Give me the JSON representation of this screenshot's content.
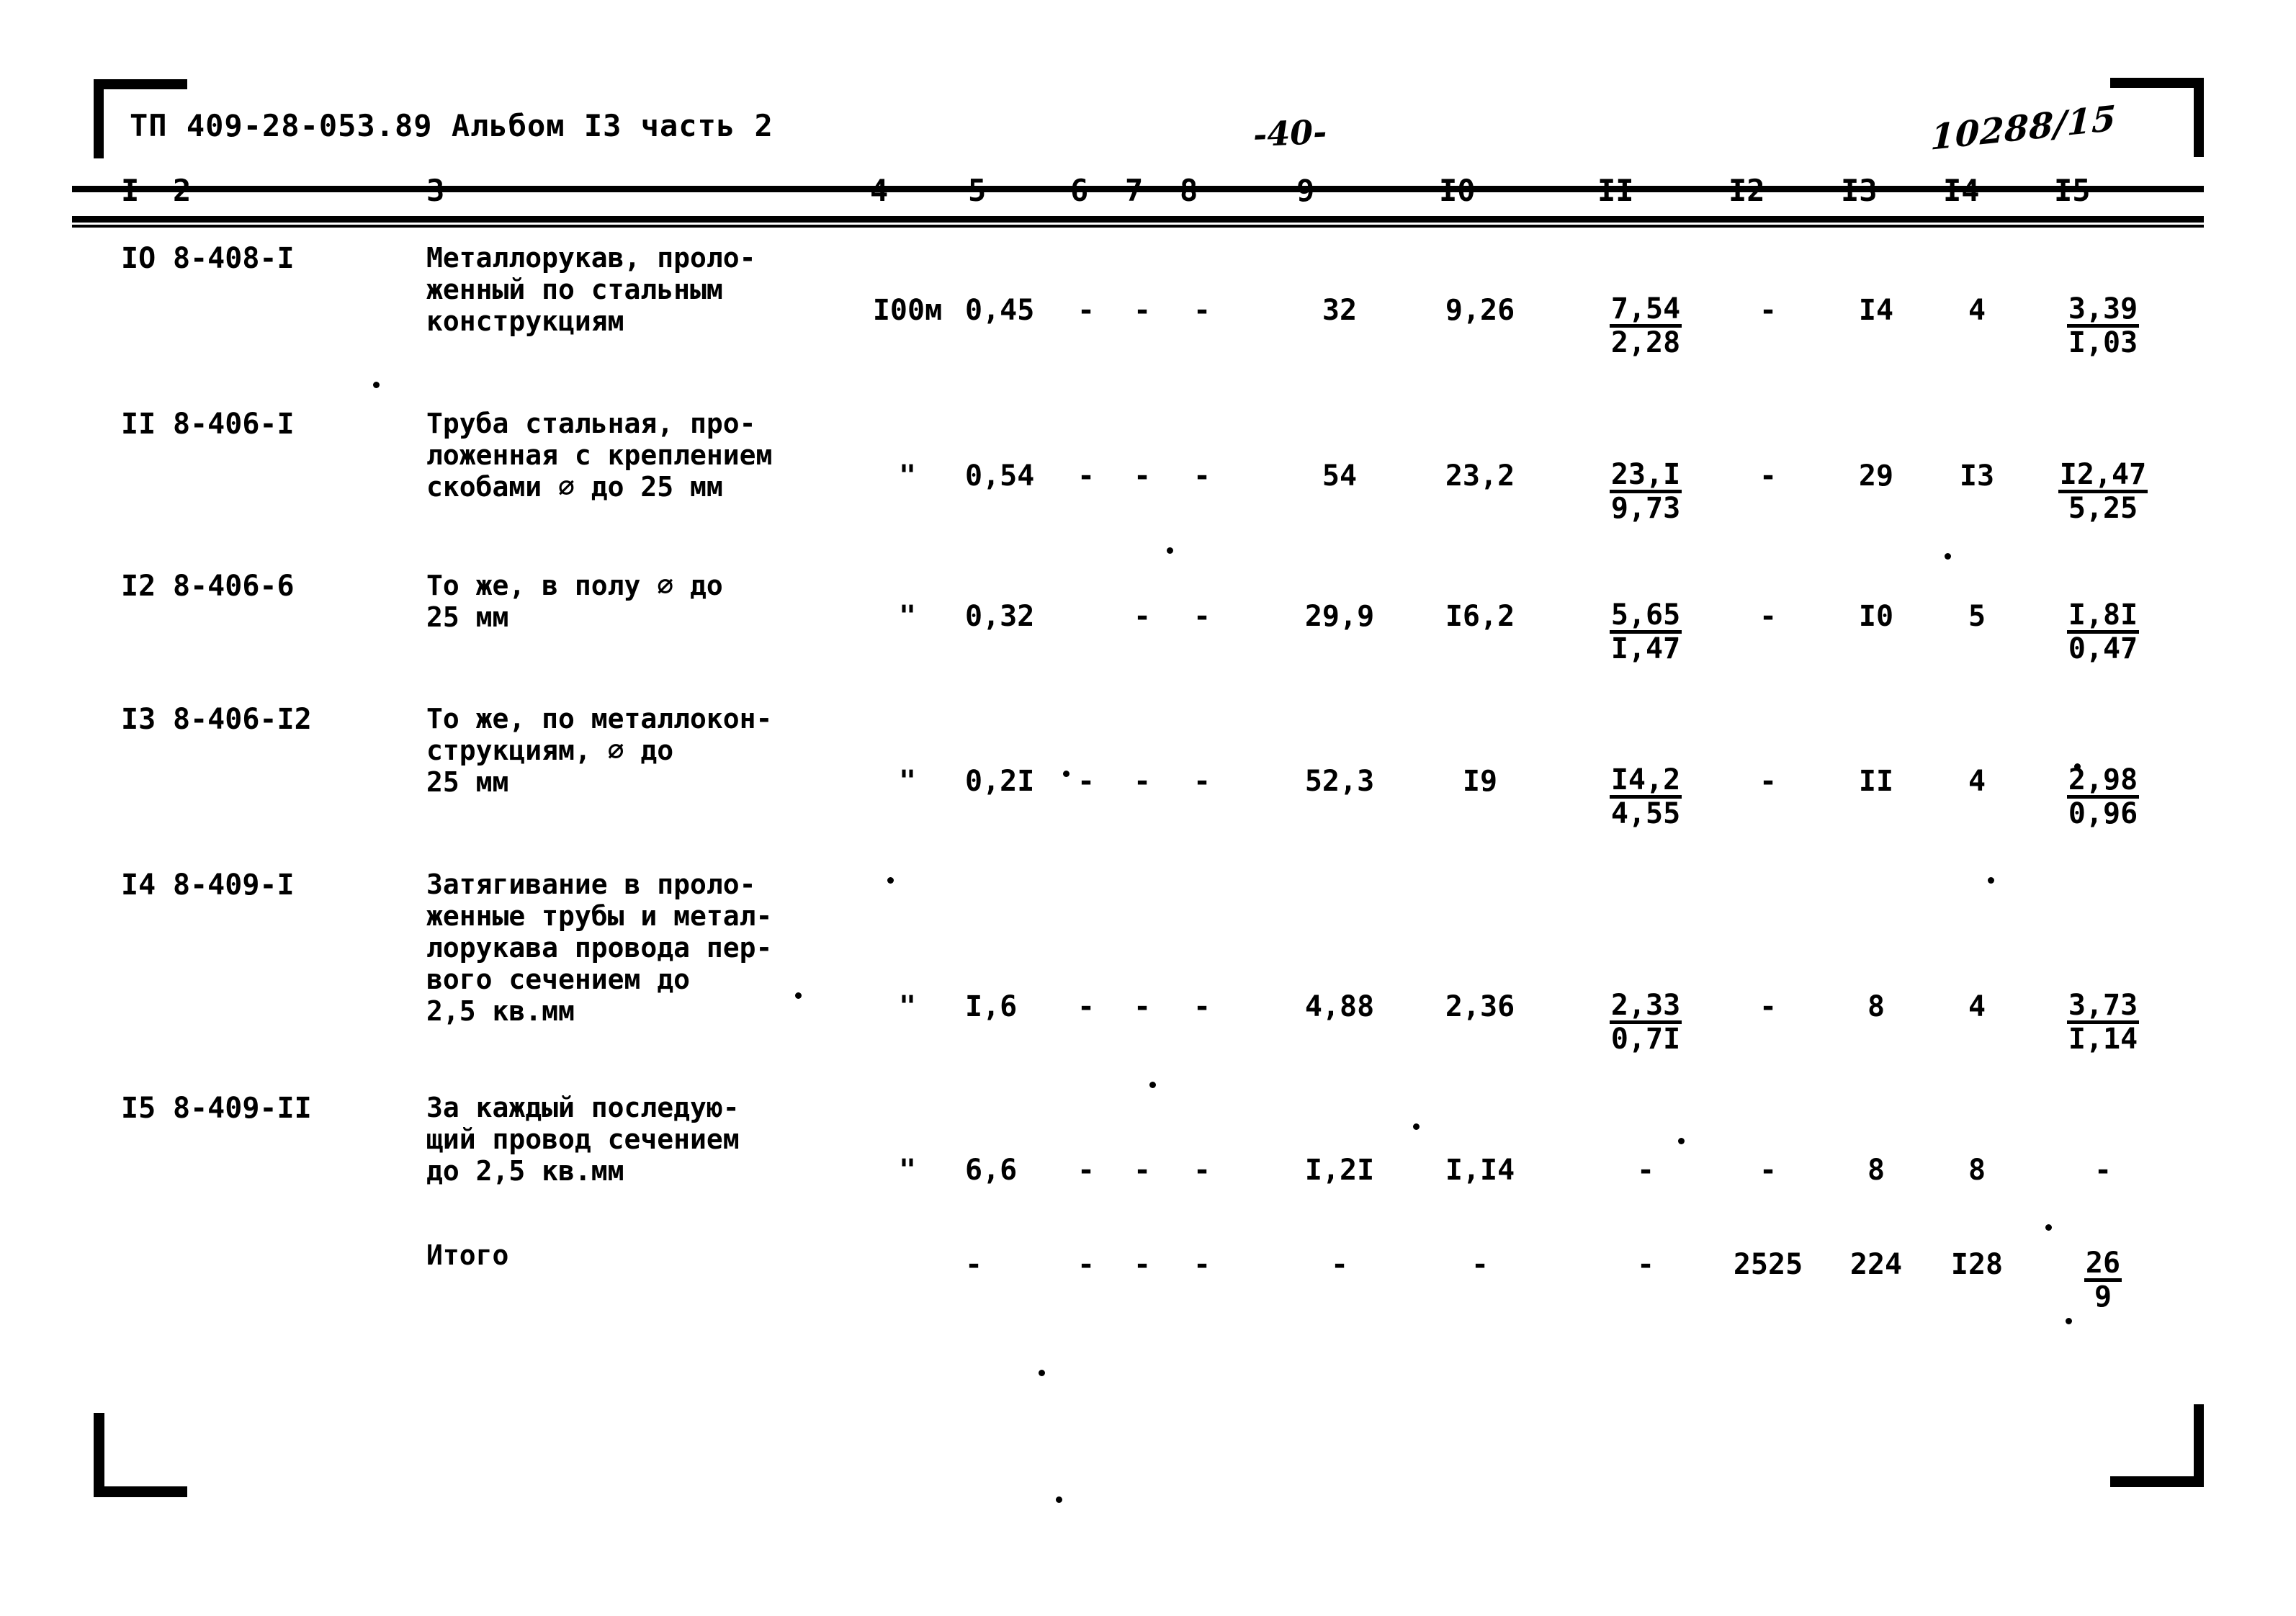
{
  "header": {
    "doc_code": "ТП 409-28-053.89 Альбом I3 часть 2",
    "page_number": "-40-",
    "stamp_number": "10288/15"
  },
  "table": {
    "column_numbers": [
      "I",
      "2",
      "3",
      "4",
      "5",
      "6",
      "7",
      "8",
      "9",
      "I0",
      "II",
      "I2",
      "I3",
      "I4",
      "I5"
    ],
    "rows": [
      {
        "no": "IO",
        "code": "8-408-I",
        "name": "Металлорукав, проло-\nженный по стальным\nконструкциям",
        "unit": "I00м",
        "c5": "0,45",
        "c6": "-",
        "c7": "-",
        "c8": "-",
        "c9": "32",
        "c10": "9,26",
        "c11_num": "7,54",
        "c11_den": "2,28",
        "c12": "-",
        "c13": "I4",
        "c14": "4",
        "c15_num": "3,39",
        "c15_den": "I,03"
      },
      {
        "no": "II",
        "code": "8-406-I",
        "name": "Труба стальная, про-\nложенная с креплением\nскобами ⌀ до 25 мм",
        "unit": "\"",
        "c5": "0,54",
        "c6": "-",
        "c7": "-",
        "c8": "-",
        "c9": "54",
        "c10": "23,2",
        "c11_num": "23,I",
        "c11_den": "9,73",
        "c12": "-",
        "c13": "29",
        "c14": "I3",
        "c15_num": "I2,47",
        "c15_den": "5,25"
      },
      {
        "no": "I2",
        "code": "8-406-6",
        "name": "То же, в полу ⌀ до\n25 мм",
        "unit": "\"",
        "c5": "0,32",
        "c6": "",
        "c7": "-",
        "c8": "-",
        "c9": "29,9",
        "c10": "I6,2",
        "c11_num": "5,65",
        "c11_den": "I,47",
        "c12": "-",
        "c13": "I0",
        "c14": "5",
        "c15_num": "I,8I",
        "c15_den": "0,47"
      },
      {
        "no": "I3",
        "code": "8-406-I2",
        "name": "То же, по металлокон-\nструкциям, ⌀ до\n25 мм",
        "unit": "\"",
        "c5": "0,2I",
        "c6": "-",
        "c7": "-",
        "c8": "-",
        "c9": "52,3",
        "c10": "I9",
        "c11_num": "I4,2",
        "c11_den": "4,55",
        "c12": "-",
        "c13": "II",
        "c14": "4",
        "c15_num": "2,98",
        "c15_den": "0,96"
      },
      {
        "no": "I4",
        "code": "8-409-I",
        "name": "Затягивание в проло-\nженные трубы и метал-\nлорукава провода пер-\nвого сечением до\n2,5 кв.мм",
        "unit": "\"",
        "c5": "I,6",
        "c6": "-",
        "c7": "-",
        "c8": "-",
        "c9": "4,88",
        "c10": "2,36",
        "c11_num": "2,33",
        "c11_den": "0,7I",
        "c12": "-",
        "c13": "8",
        "c14": "4",
        "c15_num": "3,73",
        "c15_den": "I,14"
      },
      {
        "no": "I5",
        "code": "8-409-II",
        "name": "За каждый последую-\nщий провод сечением\nдо 2,5 кв.мм",
        "unit": "\"",
        "c5": "6,6",
        "c6": "-",
        "c7": "-",
        "c8": "-",
        "c9": "I,2I",
        "c10": "I,I4",
        "c11_num": "-",
        "c11_den": "",
        "c12": "-",
        "c13": "8",
        "c14": "8",
        "c15_num": "-",
        "c15_den": ""
      },
      {
        "no": "",
        "code": "",
        "name": "Итого",
        "unit": "",
        "c5": "-",
        "c6": "-",
        "c7": "-",
        "c8": "-",
        "c9": "-",
        "c10": "-",
        "c11_num": "-",
        "c11_den": "",
        "c12": "2525",
        "c13": "224",
        "c14": "I28",
        "c15_num": "26",
        "c15_den": "9"
      }
    ]
  }
}
